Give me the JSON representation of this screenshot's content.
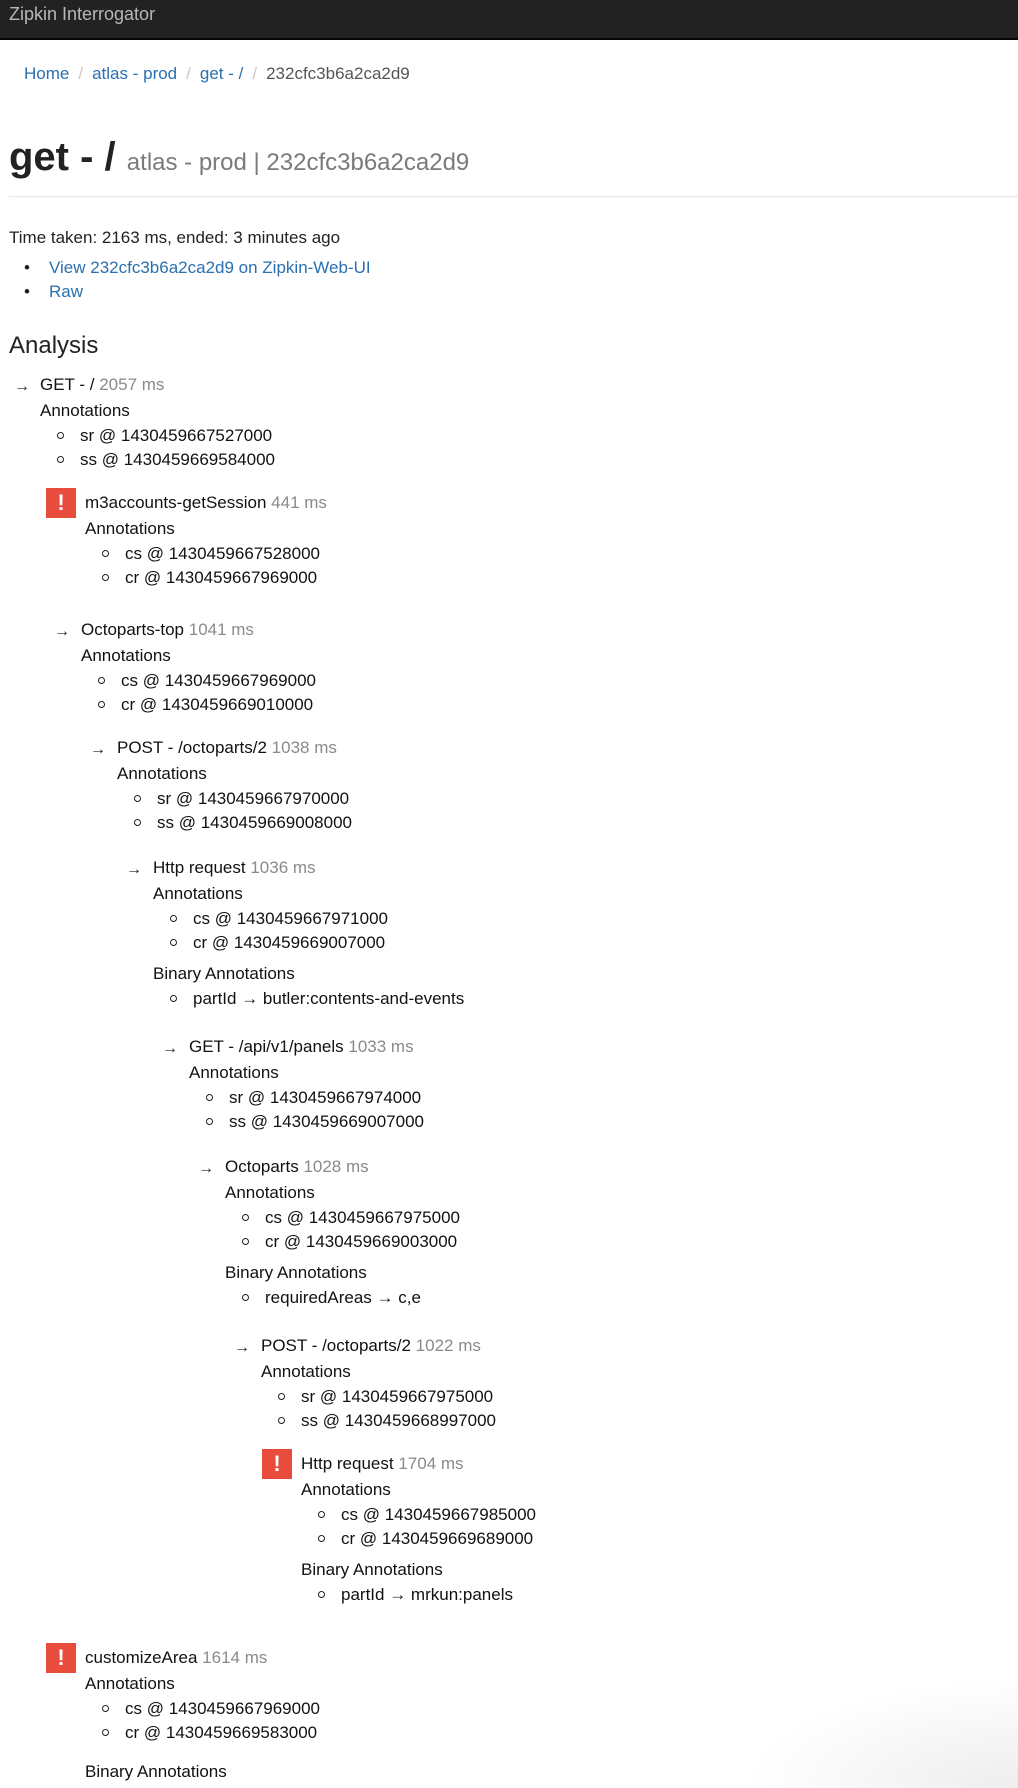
{
  "app": {
    "title": "Zipkin Interrogator"
  },
  "breadcrumb": [
    {
      "label": "Home"
    },
    {
      "label": "atlas - prod"
    },
    {
      "label": "get - /"
    },
    {
      "label": "232cfc3b6a2ca2d9"
    }
  ],
  "header": {
    "title": "get - /",
    "subtitle": "atlas - prod | 232cfc3b6a2ca2d9"
  },
  "summary": {
    "time_taken": "Time taken: 2163 ms, ended: 3 minutes ago",
    "links": [
      {
        "label": "View 232cfc3b6a2ca2d9 on Zipkin-Web-UI"
      },
      {
        "label": "Raw"
      }
    ]
  },
  "analysis": {
    "heading": "Analysis",
    "annotations_label": "Annotations",
    "binary_annotations_label": "Binary Annotations",
    "spans": [
      {
        "name": "GET - /",
        "duration": "2057 ms",
        "marker": "arrow",
        "annotations": [
          "sr @ 1430459667527000",
          "ss @ 1430459669584000"
        ]
      },
      {
        "name": "m3accounts-getSession",
        "duration": "441 ms",
        "marker": "error",
        "annotations": [
          "cs @ 1430459667528000",
          "cr @ 1430459667969000"
        ]
      },
      {
        "name": "Octoparts-top",
        "duration": "1041 ms",
        "marker": "arrow",
        "annotations": [
          "cs @ 1430459667969000",
          "cr @ 1430459669010000"
        ]
      },
      {
        "name": "POST - /octoparts/2",
        "duration": "1038 ms",
        "marker": "arrow",
        "annotations": [
          "sr @ 1430459667970000",
          "ss @ 1430459669008000"
        ]
      },
      {
        "name": "Http request",
        "duration": "1036 ms",
        "marker": "arrow",
        "annotations": [
          "cs @ 1430459667971000",
          "cr @ 1430459669007000"
        ],
        "binary_annotations": [
          "partId → butler:contents-and-events"
        ]
      },
      {
        "name": "GET - /api/v1/panels",
        "duration": "1033 ms",
        "marker": "arrow",
        "annotations": [
          "sr @ 1430459667974000",
          "ss @ 1430459669007000"
        ]
      },
      {
        "name": "Octoparts",
        "duration": "1028 ms",
        "marker": "arrow",
        "annotations": [
          "cs @ 1430459667975000",
          "cr @ 1430459669003000"
        ],
        "binary_annotations": [
          "requiredAreas → c,e"
        ]
      },
      {
        "name": "POST - /octoparts/2",
        "duration": "1022 ms",
        "marker": "arrow",
        "annotations": [
          "sr @ 1430459667975000",
          "ss @ 1430459668997000"
        ]
      },
      {
        "name": "Http request",
        "duration": "1704 ms",
        "marker": "error",
        "annotations": [
          "cs @ 1430459667985000",
          "cr @ 1430459669689000"
        ],
        "binary_annotations": [
          "partId → mrkun:panels"
        ]
      },
      {
        "name": "customizeArea",
        "duration": "1614 ms",
        "marker": "error",
        "annotations": [
          "cs @ 1430459667969000",
          "cr @ 1430459669583000"
        ]
      }
    ]
  },
  "icons": {
    "arrow": "→",
    "error": "!"
  }
}
